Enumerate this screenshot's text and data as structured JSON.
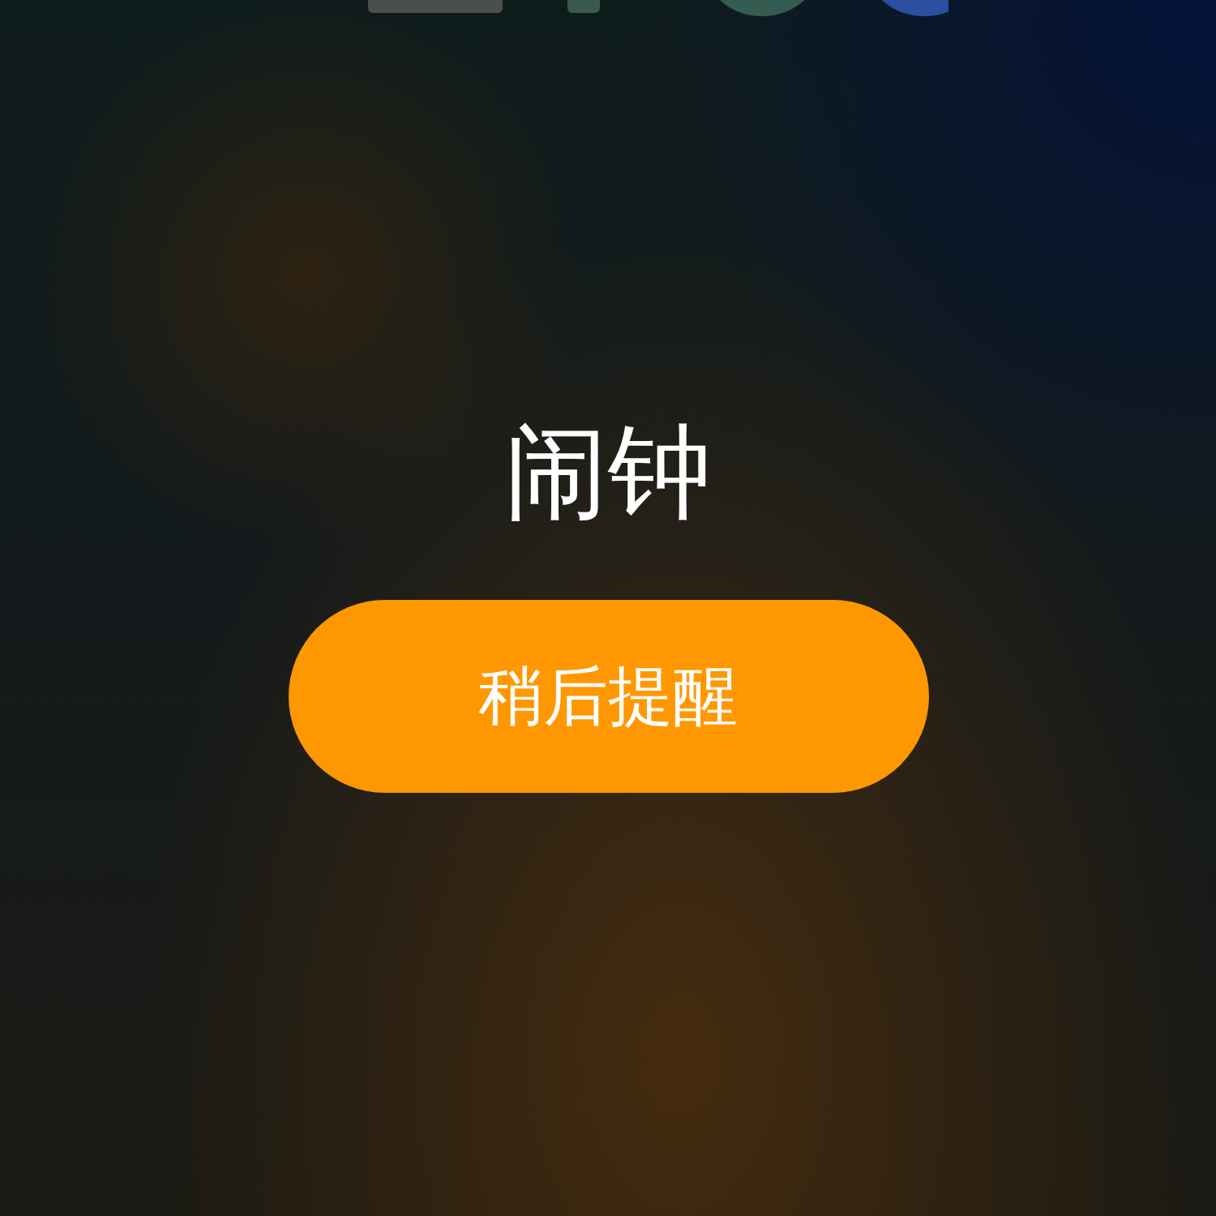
{
  "alarm": {
    "title": "闹钟",
    "snooze_button": "稍后提醒"
  }
}
